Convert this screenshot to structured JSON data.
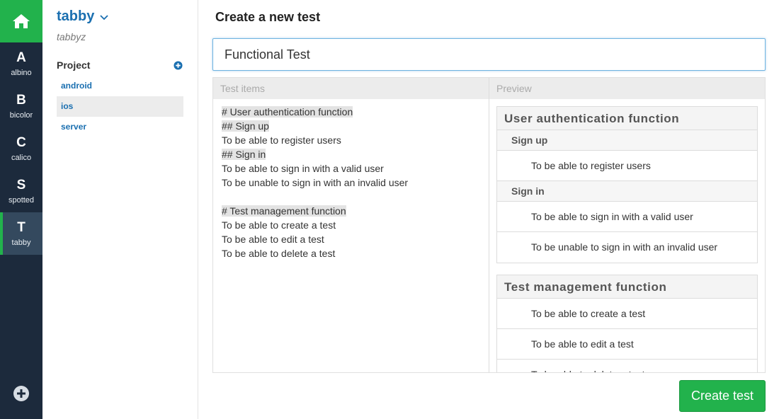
{
  "rail": {
    "home_icon": "home-icon",
    "items": [
      {
        "letter": "A",
        "name": "albino"
      },
      {
        "letter": "B",
        "name": "bicolor"
      },
      {
        "letter": "C",
        "name": "calico"
      },
      {
        "letter": "S",
        "name": "spotted"
      },
      {
        "letter": "T",
        "name": "tabby"
      }
    ],
    "active_index": 4,
    "add_icon": "plus-circle-icon"
  },
  "sidebar": {
    "org_name": "tabby",
    "user_name": "tabbyz",
    "project_label": "Project",
    "projects": [
      "android",
      "ios",
      "server"
    ],
    "active_project": "ios"
  },
  "main": {
    "title": "Create a new test",
    "test_name_value": "Functional Test",
    "editor_header": "Test items",
    "preview_header": "Preview",
    "source_lines": [
      {
        "text": "# User authentication function",
        "heading": true
      },
      {
        "text": "## Sign up",
        "heading": true
      },
      {
        "text": "To be able to register users",
        "heading": false
      },
      {
        "text": "## Sign in",
        "heading": true
      },
      {
        "text": "To be able to sign in with a valid user",
        "heading": false
      },
      {
        "text": "To be unable to sign in with an invalid user",
        "heading": false
      },
      {
        "text": "",
        "heading": false
      },
      {
        "text": "# Test management function",
        "heading": true
      },
      {
        "text": "To be able to create a test",
        "heading": false
      },
      {
        "text": "To be able to edit a test",
        "heading": false
      },
      {
        "text": "To be able to delete a test",
        "heading": false
      }
    ],
    "preview": {
      "sections": [
        {
          "title": "User authentication function",
          "subsections": [
            {
              "title": "Sign up",
              "items": [
                "To be able to register users"
              ]
            },
            {
              "title": "Sign in",
              "items": [
                "To be able to sign in with a valid user",
                "To be unable to sign in with an invalid user"
              ]
            }
          ]
        },
        {
          "title": "Test management function",
          "subsections": [
            {
              "title": "",
              "items": [
                "To be able to create a test",
                "To be able to edit a test",
                "To be able to delete a test"
              ]
            }
          ]
        }
      ]
    },
    "create_button": "Create test"
  },
  "colors": {
    "rail_bg": "#1c2a3c",
    "accent_green": "#22b24c",
    "link_blue": "#1a6fb0"
  }
}
